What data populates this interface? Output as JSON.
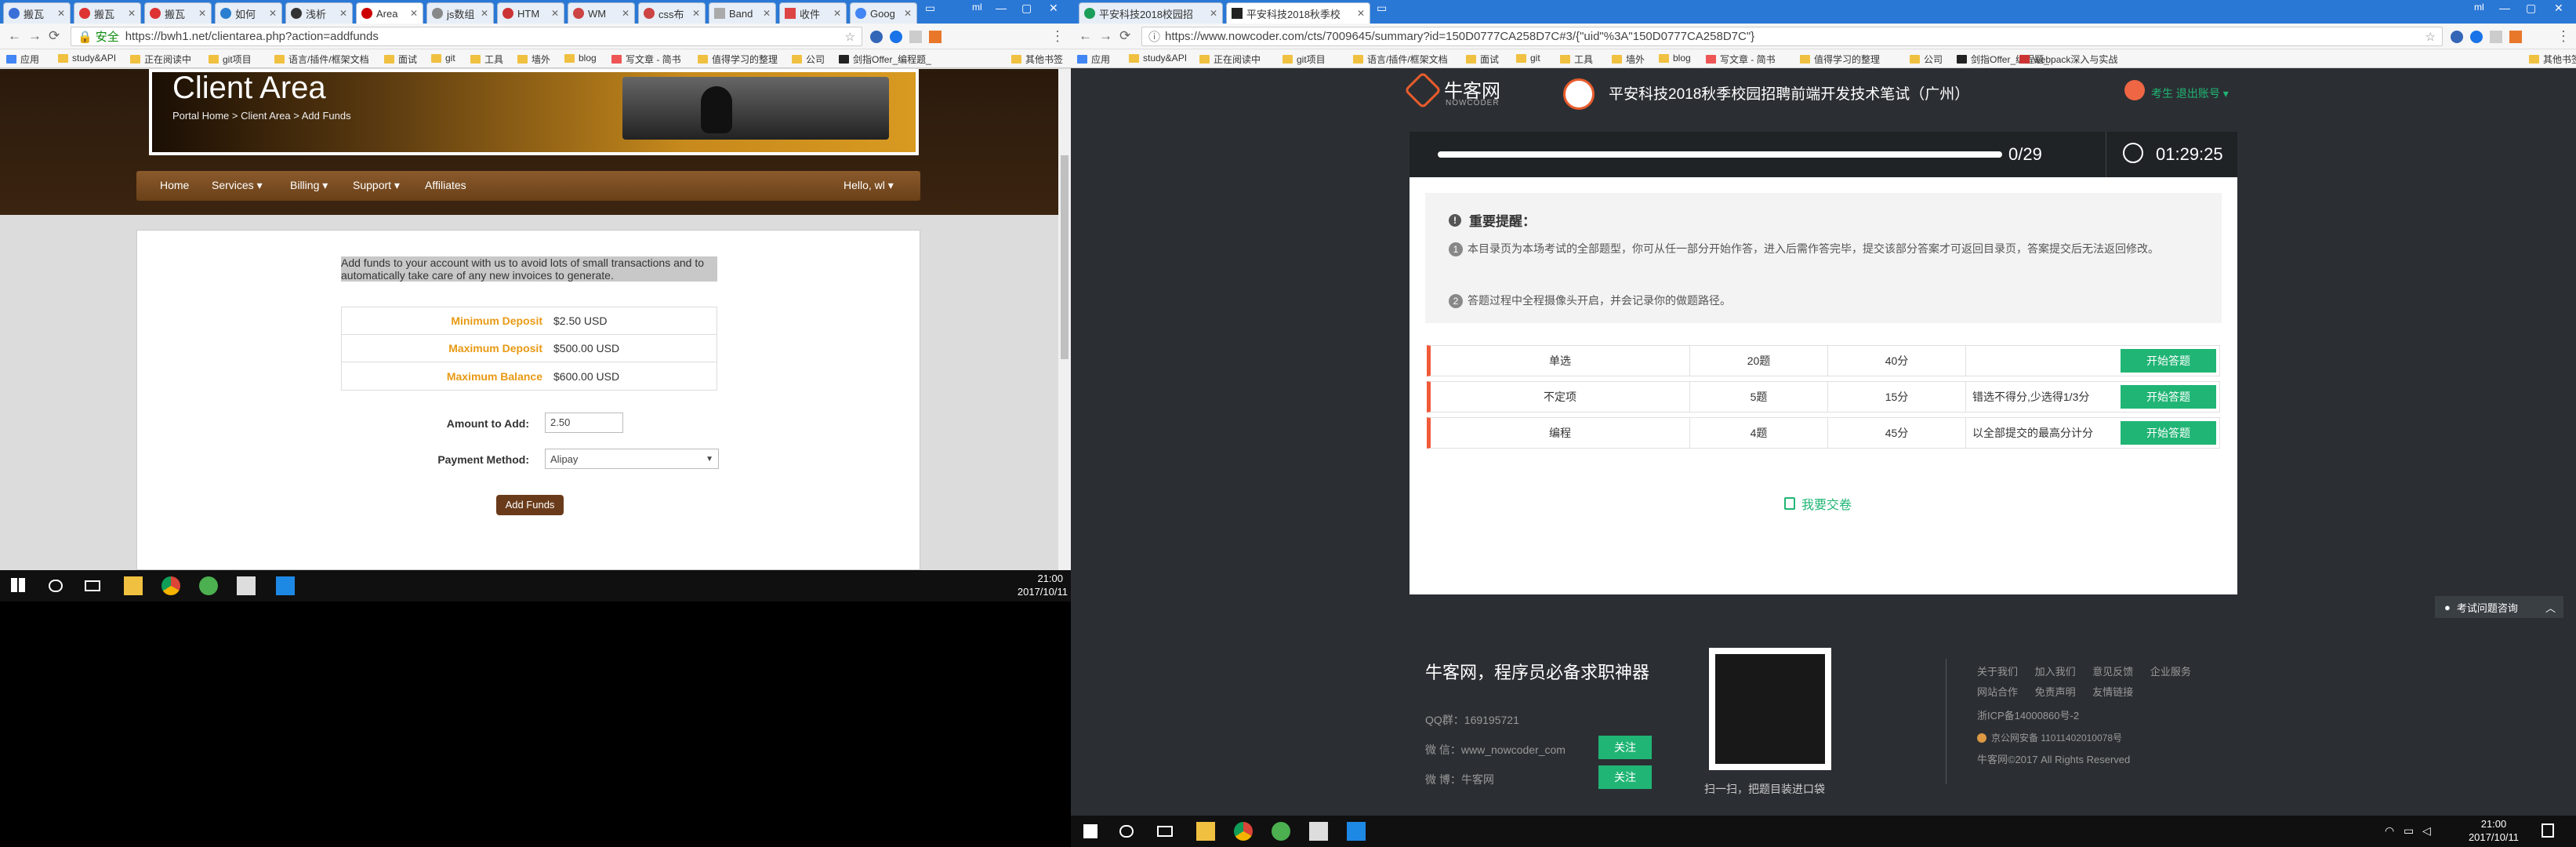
{
  "left": {
    "tabs": [
      "搬瓦",
      "搬瓦",
      "搬瓦",
      "如何",
      "浅析",
      "Area",
      "js数组",
      "HTM",
      "WM",
      "css布",
      "Band",
      "收件",
      "Goog"
    ],
    "secure_label": "安全",
    "url": "https://bwh1.net/clientarea.php?action=addfunds",
    "bookmarks": [
      "应用",
      "study&API",
      "正在阅读中",
      "git项目",
      "语言/插件/框架文档",
      "面试",
      "git",
      "工具",
      "墙外",
      "blog",
      "写文章 - 简书",
      "值得学习的整理",
      "公司",
      "剑指Offer_编程题_",
      "其他书签"
    ],
    "header": {
      "title": "Client Area",
      "breadcrumb": "Portal Home > Client Area > Add Funds"
    },
    "nav": [
      "Home",
      "Services",
      "Billing",
      "Support",
      "Affiliates",
      "Hello, wl"
    ],
    "intro": "Add funds to your account with us to avoid lots of small transactions and to automatically take care of any new invoices to generate.",
    "limits": [
      {
        "label": "Minimum Deposit",
        "value": "$2.50 USD"
      },
      {
        "label": "Maximum Deposit",
        "value": "$500.00 USD"
      },
      {
        "label": "Maximum Balance",
        "value": "$600.00 USD"
      }
    ],
    "amount_label": "Amount to Add:",
    "amount_value": "2.50",
    "payment_label": "Payment Method:",
    "payment_value": "Alipay",
    "submit": "Add Funds",
    "clock_time": "21:00",
    "clock_date": "2017/10/11"
  },
  "right": {
    "tabs": [
      "平安科技2018校园招",
      "平安科技2018秋季校"
    ],
    "url": "https://www.nowcoder.com/cts/7009645/summary?id=150D0777CA258D7C#3/{\"uid\"%3A\"150D0777CA258D7C\"}",
    "bookmarks": [
      "应用",
      "study&API",
      "正在阅读中",
      "git项目",
      "语言/插件/框架文档",
      "面试",
      "git",
      "工具",
      "墙外",
      "blog",
      "写文章 - 简书",
      "值得学习的整理",
      "公司",
      "剑指Offer_编程题_",
      "webpack深入与实战",
      "其他书签"
    ],
    "logo": "牛客网",
    "logo_sub": "NOWCODER",
    "exam_title": "平安科技2018秋季校园招聘前端开发技术笔试（广州）",
    "user_label": "考生",
    "logout": "退出账号",
    "progress_text": "0/29",
    "progress_fraction": 0.0,
    "timer": "01:29:25",
    "notice_title": "重要提醒",
    "notice_1": "本目录页为本场考试的全部题型，你可从任一部分开始作答，进入后需作答完毕，提交该部分答案才可返回目录页，答案提交后无法返回修改。",
    "notice_2": "答题过程中全程摄像头开启，并会记录你的做题路径。",
    "sections": [
      {
        "type": "单选",
        "count": "20题",
        "time": "40分",
        "note": "",
        "btn": "开始答题"
      },
      {
        "type": "不定项",
        "count": "5题",
        "time": "15分",
        "note": "错选不得分,少选得1/3分",
        "btn": "开始答题"
      },
      {
        "type": "编程",
        "count": "4题",
        "time": "45分",
        "note": "以全部提交的最高分计分",
        "btn": "开始答题"
      }
    ],
    "submit_paper": "我要交卷",
    "help": "考试问题咨询",
    "footer": {
      "slogan": "牛客网，程序员必备求职神器",
      "qq": "QQ群：169195721",
      "wechat": "微 信：www_nowcoder_com",
      "weibo": "微 博：牛客网",
      "follow": "关注",
      "qr_caption": "扫一扫，把题目装进口袋",
      "links1": [
        "关于我们",
        "加入我们",
        "意见反馈",
        "企业服务"
      ],
      "links2": [
        "网站合作",
        "免责声明",
        "友情链接"
      ],
      "icp": "浙ICP备14000860号-2",
      "police": "京公网安备 11011402010078号",
      "copyright": "牛客网©2017 All Rights Reserved"
    },
    "clock_time": "21:00",
    "clock_date": "2017/10/11"
  },
  "colors": {
    "accent_green": "#20b575",
    "brown": "#5a2d10",
    "dark": "#2b2f33",
    "red_marker": "#f05a38",
    "client_orange": "#e89a14"
  }
}
